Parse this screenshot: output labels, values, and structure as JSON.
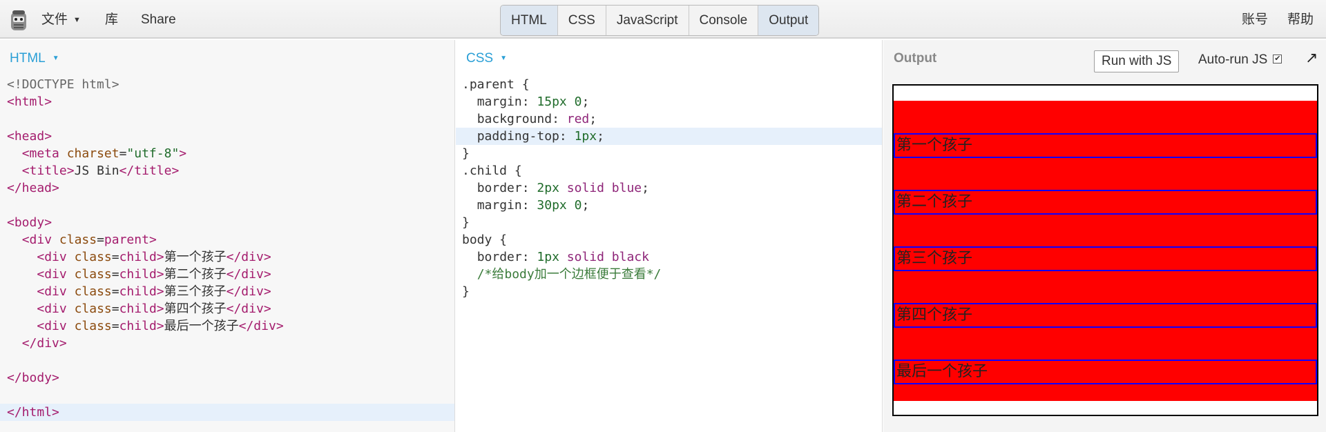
{
  "topbar": {
    "file_menu": "文件",
    "library": "库",
    "share": "Share",
    "tabs": [
      "HTML",
      "CSS",
      "JavaScript",
      "Console",
      "Output"
    ],
    "account": "账号",
    "help": "帮助"
  },
  "html_pane": {
    "label": "HTML",
    "lines": [
      "<!DOCTYPE html>",
      "<html>",
      "",
      "<head>",
      "  <meta charset=\"utf-8\">",
      "  <title>JS Bin</title>",
      "</head>",
      "",
      "<body>",
      "  <div class=parent>",
      "    <div class=child>第一个孩子</div>",
      "    <div class=child>第二个孩子</div>",
      "    <div class=child>第三个孩子</div>",
      "    <div class=child>第四个孩子</div>",
      "    <div class=child>最后一个孩子</div>",
      "  </div>",
      "",
      "</body>",
      "",
      "</html>"
    ]
  },
  "css_pane": {
    "label": "CSS",
    "lines": [
      ".parent {",
      "  margin: 15px 0;",
      "  background: red;",
      "  padding-top: 1px;",
      "}",
      ".child {",
      "  border: 2px solid blue;",
      "  margin: 30px 0;",
      "}",
      "body {",
      "  border: 1px solid black",
      "  /*给body加一个边框便于查看*/",
      "}"
    ]
  },
  "output_pane": {
    "label": "Output",
    "run_button": "Run with JS",
    "autorun_label": "Auto-run JS",
    "autorun_checked": "✔",
    "popout_icon": "↗",
    "children": [
      "第一个孩子",
      "第二个孩子",
      "第三个孩子",
      "第四个孩子",
      "最后一个孩子"
    ]
  },
  "colors": {
    "accent": "#2a9fd6",
    "parent_bg": "#ff0000",
    "child_border": "#1000ff"
  }
}
